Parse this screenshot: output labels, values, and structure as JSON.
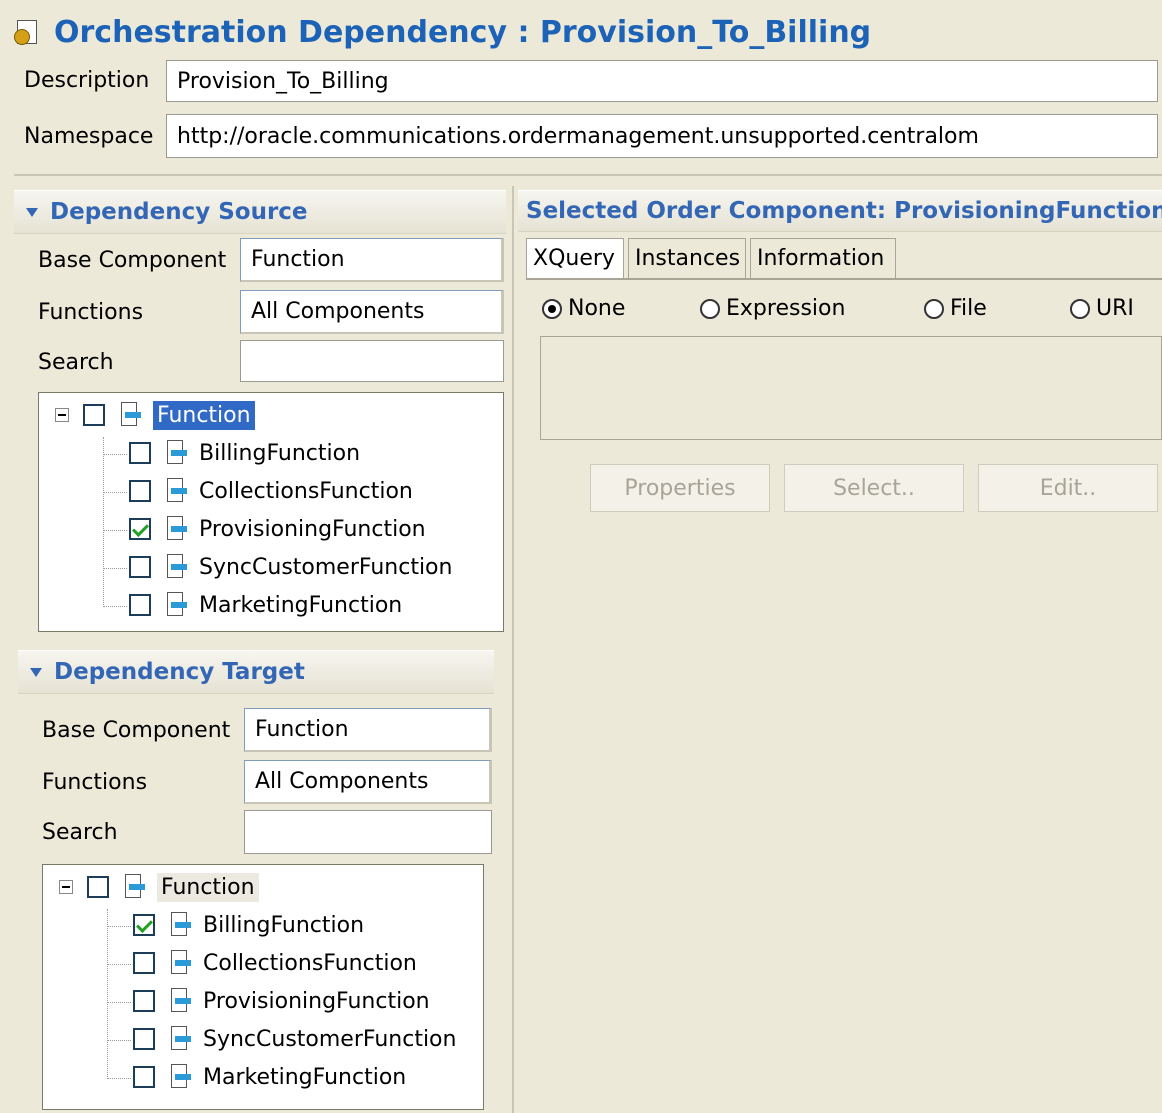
{
  "title": "Orchestration Dependency : Provision_To_Billing",
  "header": {
    "description_label": "Description",
    "description_value": "Provision_To_Billing",
    "namespace_label": "Namespace",
    "namespace_value": "http://oracle.communications.ordermanagement.unsupported.centralom"
  },
  "source": {
    "title": "Dependency Source",
    "base_label": "Base Component",
    "base_value": "Function",
    "functions_label": "Functions",
    "functions_value": "All Components",
    "search_label": "Search",
    "search_value": "",
    "tree": {
      "root": "Function",
      "items": [
        {
          "label": "BillingFunction",
          "checked": false
        },
        {
          "label": "CollectionsFunction",
          "checked": false
        },
        {
          "label": "ProvisioningFunction",
          "checked": true
        },
        {
          "label": "SyncCustomerFunction",
          "checked": false
        },
        {
          "label": "MarketingFunction",
          "checked": false
        }
      ]
    }
  },
  "target": {
    "title": "Dependency Target",
    "base_label": "Base Component",
    "base_value": "Function",
    "functions_label": "Functions",
    "functions_value": "All Components",
    "search_label": "Search",
    "search_value": "",
    "tree": {
      "root": "Function",
      "items": [
        {
          "label": "BillingFunction",
          "checked": true
        },
        {
          "label": "CollectionsFunction",
          "checked": false
        },
        {
          "label": "ProvisioningFunction",
          "checked": false
        },
        {
          "label": "SyncCustomerFunction",
          "checked": false
        },
        {
          "label": "MarketingFunction",
          "checked": false
        }
      ]
    }
  },
  "right": {
    "title": "Selected Order Component: ProvisioningFunction",
    "tabs": [
      "XQuery",
      "Instances",
      "Information"
    ],
    "active_tab": 0,
    "radios": [
      {
        "label": "None",
        "selected": true
      },
      {
        "label": "Expression",
        "selected": false
      },
      {
        "label": "File",
        "selected": false
      },
      {
        "label": "URI",
        "selected": false
      }
    ],
    "buttons": {
      "properties": "Properties",
      "select": "Select..",
      "edit": "Edit.."
    }
  },
  "colors": {
    "accent": "#1c63b8",
    "background": "#ece9d8",
    "selection": "#3169c6",
    "check": "#21a121"
  }
}
